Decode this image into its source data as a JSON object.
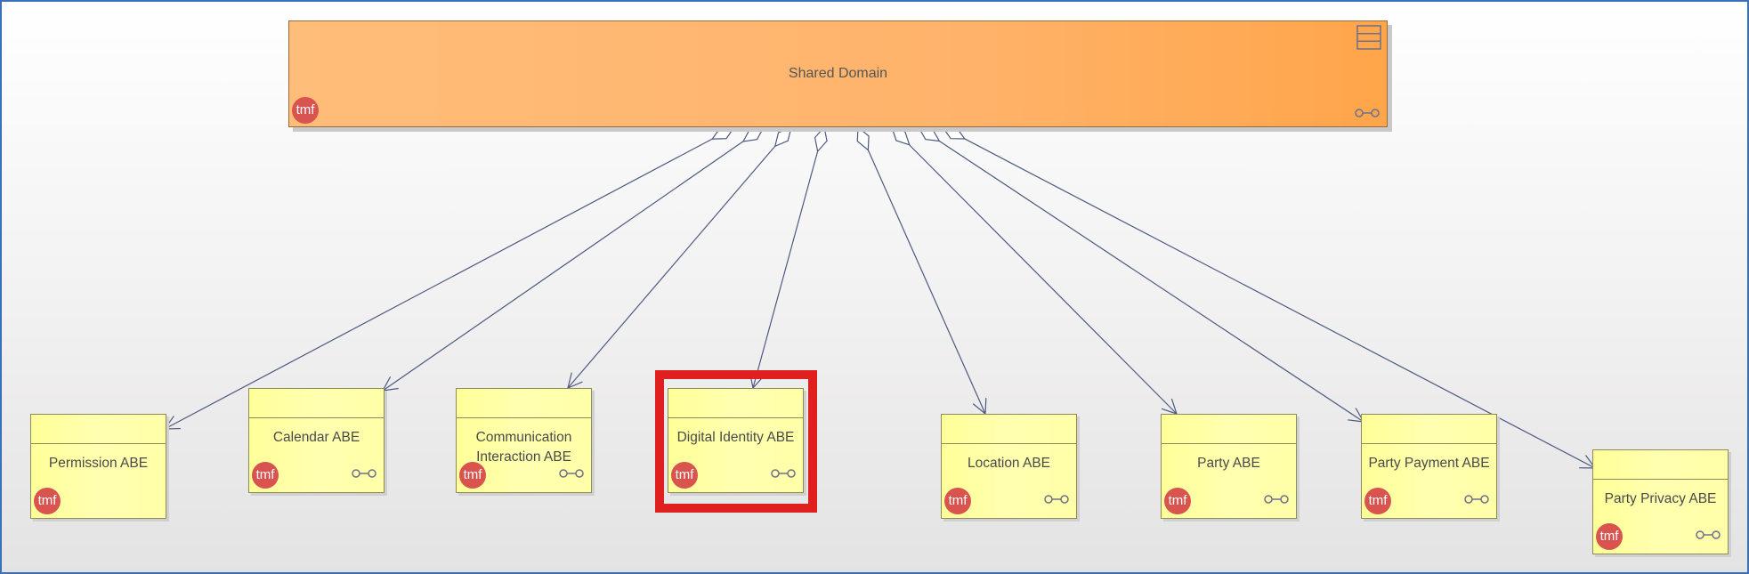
{
  "diagram": {
    "domain": {
      "label": "Shared Domain",
      "badge": "tmf",
      "menu_icon": "menu-icon",
      "link_icon": "link-icon"
    },
    "abes": [
      {
        "id": "permission",
        "label": "Permission ABE",
        "badge": "tmf",
        "has_link_icon": false
      },
      {
        "id": "calendar",
        "label": "Calendar ABE",
        "badge": "tmf",
        "has_link_icon": true
      },
      {
        "id": "communication",
        "label": "Communication Interaction ABE",
        "badge": "tmf",
        "has_link_icon": true
      },
      {
        "id": "digital-identity",
        "label": "Digital Identity ABE",
        "badge": "tmf",
        "has_link_icon": true,
        "highlighted": true
      },
      {
        "id": "location",
        "label": "Location ABE",
        "badge": "tmf",
        "has_link_icon": true
      },
      {
        "id": "party",
        "label": "Party ABE",
        "badge": "tmf",
        "has_link_icon": true
      },
      {
        "id": "party-payment",
        "label": "Party Payment ABE",
        "badge": "tmf",
        "has_link_icon": true
      },
      {
        "id": "party-privacy",
        "label": "Party Privacy ABE",
        "badge": "tmf",
        "has_link_icon": true
      }
    ],
    "relationships": [
      {
        "from": "Shared Domain",
        "to": "Permission ABE",
        "type": "aggregation"
      },
      {
        "from": "Shared Domain",
        "to": "Calendar ABE",
        "type": "aggregation"
      },
      {
        "from": "Shared Domain",
        "to": "Communication Interaction ABE",
        "type": "aggregation"
      },
      {
        "from": "Shared Domain",
        "to": "Digital Identity ABE",
        "type": "aggregation"
      },
      {
        "from": "Shared Domain",
        "to": "Location ABE",
        "type": "aggregation"
      },
      {
        "from": "Shared Domain",
        "to": "Party ABE",
        "type": "aggregation"
      },
      {
        "from": "Shared Domain",
        "to": "Party Payment ABE",
        "type": "aggregation"
      },
      {
        "from": "Shared Domain",
        "to": "Party Privacy ABE",
        "type": "aggregation"
      }
    ],
    "colors": {
      "domain_fill": "#ffb36b",
      "abe_fill": "#ffffa8",
      "connector": "#4d5a80",
      "badge": "#d9534f",
      "highlight": "#e0201f",
      "frame_border": "#3b6fb6"
    }
  }
}
